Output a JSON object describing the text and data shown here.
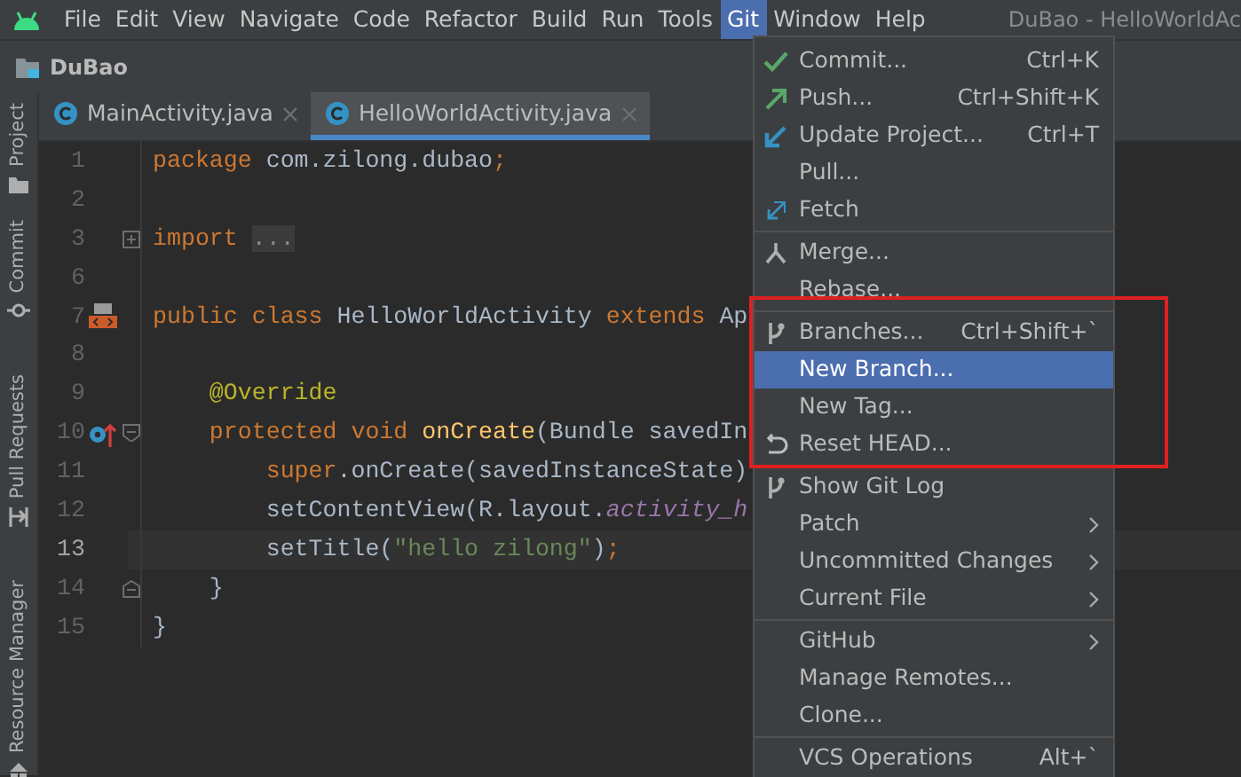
{
  "menubar": {
    "items": [
      {
        "label": "File",
        "selected": false
      },
      {
        "label": "Edit",
        "selected": false
      },
      {
        "label": "View",
        "selected": false
      },
      {
        "label": "Navigate",
        "selected": false
      },
      {
        "label": "Code",
        "selected": false
      },
      {
        "label": "Refactor",
        "selected": false
      },
      {
        "label": "Build",
        "selected": false
      },
      {
        "label": "Run",
        "selected": false
      },
      {
        "label": "Tools",
        "selected": false
      },
      {
        "label": "Git",
        "selected": true
      },
      {
        "label": "Window",
        "selected": false
      },
      {
        "label": "Help",
        "selected": false
      }
    ],
    "window_title": "DuBao - HelloWorldAc"
  },
  "project": {
    "name": "DuBao"
  },
  "tool_strip": [
    {
      "label": "Project"
    },
    {
      "label": "Commit"
    },
    {
      "label": "Pull Requests"
    },
    {
      "label": "Resource Manager"
    }
  ],
  "tabs": [
    {
      "label": "MainActivity.java",
      "selected": false
    },
    {
      "label": "HelloWorldActivity.java",
      "selected": true
    }
  ],
  "editor": {
    "lines": [
      {
        "number": "1",
        "current": false,
        "tokens": [
          {
            "text": "package",
            "kind": "kw"
          },
          {
            "text": " com.zilong.dubao",
            "kind": "plain"
          },
          {
            "text": ";",
            "kind": "kw"
          }
        ]
      },
      {
        "number": "2",
        "current": false
      },
      {
        "number": "3",
        "current": false,
        "tokens": [
          {
            "text": "import ",
            "kind": "kw"
          },
          {
            "text": "...",
            "kind": "folded"
          }
        ]
      },
      {
        "number": "6",
        "current": false
      },
      {
        "number": "7",
        "current": false,
        "tokens": [
          {
            "text": "public class",
            "kind": "kw"
          },
          {
            "text": " HelloWorldActivity ",
            "kind": "plain"
          },
          {
            "text": "extends",
            "kind": "kw"
          },
          {
            "text": " Ap",
            "kind": "plain"
          }
        ]
      },
      {
        "number": "8",
        "current": false
      },
      {
        "number": "9",
        "current": false,
        "tokens": [
          {
            "text": "    @Override",
            "kind": "ann"
          }
        ]
      },
      {
        "number": "10",
        "current": false,
        "tokens": [
          {
            "text": "    protected void ",
            "kind": "kw"
          },
          {
            "text": "onCreate",
            "kind": "method"
          },
          {
            "text": "(Bundle savedIn",
            "kind": "plain"
          }
        ]
      },
      {
        "number": "11",
        "current": false,
        "tokens": [
          {
            "text": "        super",
            "kind": "kw"
          },
          {
            "text": ".onCreate(savedInstanceState)",
            "kind": "plain"
          }
        ]
      },
      {
        "number": "12",
        "current": false,
        "tokens": [
          {
            "text": "        setContentView(R.layout.",
            "kind": "plain"
          },
          {
            "text": "activity_h",
            "kind": "field"
          }
        ]
      },
      {
        "number": "13",
        "current": true,
        "tokens": [
          {
            "text": "        setTitle(",
            "kind": "plain"
          },
          {
            "text": "\"hello zilong\"",
            "kind": "str"
          },
          {
            "text": ")",
            "kind": "plain"
          },
          {
            "text": ";",
            "kind": "kw"
          }
        ]
      },
      {
        "number": "14",
        "current": false,
        "tokens": [
          {
            "text": "    }",
            "kind": "plain"
          }
        ]
      },
      {
        "number": "15",
        "current": false,
        "tokens": [
          {
            "text": "}",
            "kind": "plain"
          }
        ]
      }
    ]
  },
  "git_menu": {
    "sections": [
      {
        "items": [
          {
            "label": "Commit...",
            "shortcut": "Ctrl+K",
            "selected": false
          },
          {
            "label": "Push...",
            "shortcut": "Ctrl+Shift+K",
            "selected": false
          },
          {
            "label": "Update Project...",
            "shortcut": "Ctrl+T",
            "selected": false
          },
          {
            "label": "Pull...",
            "selected": false
          },
          {
            "label": "Fetch",
            "selected": false
          }
        ]
      },
      {
        "items": [
          {
            "label": "Merge...",
            "selected": false
          },
          {
            "label": "Rebase...",
            "selected": false
          }
        ]
      },
      {
        "highlighted": true,
        "items": [
          {
            "label": "Branches...",
            "shortcut": "Ctrl+Shift+`",
            "selected": false
          },
          {
            "label": "New Branch...",
            "selected": true
          },
          {
            "label": "New Tag...",
            "selected": false
          },
          {
            "label": "Reset HEAD...",
            "selected": false
          }
        ]
      },
      {
        "items": [
          {
            "label": "Show Git Log",
            "selected": false
          },
          {
            "label": "Patch",
            "submenu": true,
            "selected": false
          },
          {
            "label": "Uncommitted Changes",
            "submenu": true,
            "selected": false
          },
          {
            "label": "Current File",
            "submenu": true,
            "selected": false
          }
        ]
      },
      {
        "items": [
          {
            "label": "GitHub",
            "submenu": true,
            "selected": false
          },
          {
            "label": "Manage Remotes...",
            "selected": false
          },
          {
            "label": "Clone...",
            "selected": false
          }
        ]
      },
      {
        "items": [
          {
            "label": "VCS Operations",
            "shortcut": "Alt+`",
            "selected": false
          }
        ]
      }
    ]
  }
}
